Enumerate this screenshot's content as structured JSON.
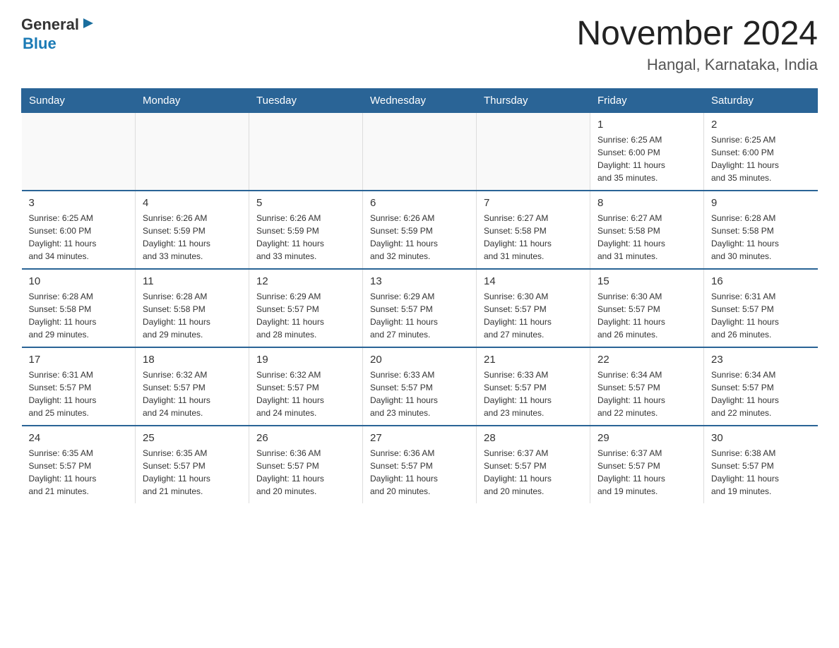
{
  "header": {
    "logo_text_general": "General",
    "logo_text_blue": "Blue",
    "calendar_title": "November 2024",
    "calendar_subtitle": "Hangal, Karnataka, India"
  },
  "weekdays": [
    "Sunday",
    "Monday",
    "Tuesday",
    "Wednesday",
    "Thursday",
    "Friday",
    "Saturday"
  ],
  "weeks": [
    [
      {
        "day": "",
        "info": ""
      },
      {
        "day": "",
        "info": ""
      },
      {
        "day": "",
        "info": ""
      },
      {
        "day": "",
        "info": ""
      },
      {
        "day": "",
        "info": ""
      },
      {
        "day": "1",
        "info": "Sunrise: 6:25 AM\nSunset: 6:00 PM\nDaylight: 11 hours\nand 35 minutes."
      },
      {
        "day": "2",
        "info": "Sunrise: 6:25 AM\nSunset: 6:00 PM\nDaylight: 11 hours\nand 35 minutes."
      }
    ],
    [
      {
        "day": "3",
        "info": "Sunrise: 6:25 AM\nSunset: 6:00 PM\nDaylight: 11 hours\nand 34 minutes."
      },
      {
        "day": "4",
        "info": "Sunrise: 6:26 AM\nSunset: 5:59 PM\nDaylight: 11 hours\nand 33 minutes."
      },
      {
        "day": "5",
        "info": "Sunrise: 6:26 AM\nSunset: 5:59 PM\nDaylight: 11 hours\nand 33 minutes."
      },
      {
        "day": "6",
        "info": "Sunrise: 6:26 AM\nSunset: 5:59 PM\nDaylight: 11 hours\nand 32 minutes."
      },
      {
        "day": "7",
        "info": "Sunrise: 6:27 AM\nSunset: 5:58 PM\nDaylight: 11 hours\nand 31 minutes."
      },
      {
        "day": "8",
        "info": "Sunrise: 6:27 AM\nSunset: 5:58 PM\nDaylight: 11 hours\nand 31 minutes."
      },
      {
        "day": "9",
        "info": "Sunrise: 6:28 AM\nSunset: 5:58 PM\nDaylight: 11 hours\nand 30 minutes."
      }
    ],
    [
      {
        "day": "10",
        "info": "Sunrise: 6:28 AM\nSunset: 5:58 PM\nDaylight: 11 hours\nand 29 minutes."
      },
      {
        "day": "11",
        "info": "Sunrise: 6:28 AM\nSunset: 5:58 PM\nDaylight: 11 hours\nand 29 minutes."
      },
      {
        "day": "12",
        "info": "Sunrise: 6:29 AM\nSunset: 5:57 PM\nDaylight: 11 hours\nand 28 minutes."
      },
      {
        "day": "13",
        "info": "Sunrise: 6:29 AM\nSunset: 5:57 PM\nDaylight: 11 hours\nand 27 minutes."
      },
      {
        "day": "14",
        "info": "Sunrise: 6:30 AM\nSunset: 5:57 PM\nDaylight: 11 hours\nand 27 minutes."
      },
      {
        "day": "15",
        "info": "Sunrise: 6:30 AM\nSunset: 5:57 PM\nDaylight: 11 hours\nand 26 minutes."
      },
      {
        "day": "16",
        "info": "Sunrise: 6:31 AM\nSunset: 5:57 PM\nDaylight: 11 hours\nand 26 minutes."
      }
    ],
    [
      {
        "day": "17",
        "info": "Sunrise: 6:31 AM\nSunset: 5:57 PM\nDaylight: 11 hours\nand 25 minutes."
      },
      {
        "day": "18",
        "info": "Sunrise: 6:32 AM\nSunset: 5:57 PM\nDaylight: 11 hours\nand 24 minutes."
      },
      {
        "day": "19",
        "info": "Sunrise: 6:32 AM\nSunset: 5:57 PM\nDaylight: 11 hours\nand 24 minutes."
      },
      {
        "day": "20",
        "info": "Sunrise: 6:33 AM\nSunset: 5:57 PM\nDaylight: 11 hours\nand 23 minutes."
      },
      {
        "day": "21",
        "info": "Sunrise: 6:33 AM\nSunset: 5:57 PM\nDaylight: 11 hours\nand 23 minutes."
      },
      {
        "day": "22",
        "info": "Sunrise: 6:34 AM\nSunset: 5:57 PM\nDaylight: 11 hours\nand 22 minutes."
      },
      {
        "day": "23",
        "info": "Sunrise: 6:34 AM\nSunset: 5:57 PM\nDaylight: 11 hours\nand 22 minutes."
      }
    ],
    [
      {
        "day": "24",
        "info": "Sunrise: 6:35 AM\nSunset: 5:57 PM\nDaylight: 11 hours\nand 21 minutes."
      },
      {
        "day": "25",
        "info": "Sunrise: 6:35 AM\nSunset: 5:57 PM\nDaylight: 11 hours\nand 21 minutes."
      },
      {
        "day": "26",
        "info": "Sunrise: 6:36 AM\nSunset: 5:57 PM\nDaylight: 11 hours\nand 20 minutes."
      },
      {
        "day": "27",
        "info": "Sunrise: 6:36 AM\nSunset: 5:57 PM\nDaylight: 11 hours\nand 20 minutes."
      },
      {
        "day": "28",
        "info": "Sunrise: 6:37 AM\nSunset: 5:57 PM\nDaylight: 11 hours\nand 20 minutes."
      },
      {
        "day": "29",
        "info": "Sunrise: 6:37 AM\nSunset: 5:57 PM\nDaylight: 11 hours\nand 19 minutes."
      },
      {
        "day": "30",
        "info": "Sunrise: 6:38 AM\nSunset: 5:57 PM\nDaylight: 11 hours\nand 19 minutes."
      }
    ]
  ]
}
